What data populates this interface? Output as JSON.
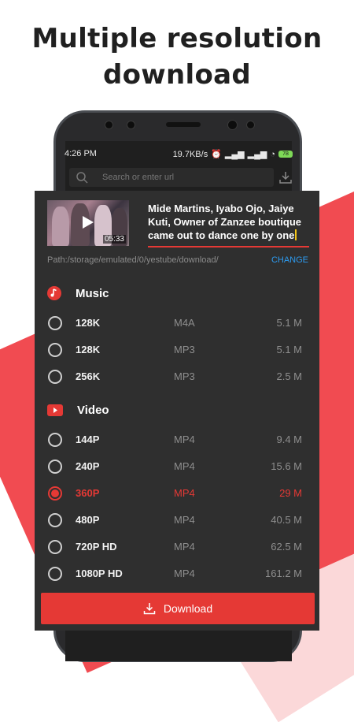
{
  "headline": {
    "line1": "Multiple resolution",
    "line2": "download"
  },
  "status_bar": {
    "time": "4:26 PM",
    "speed": "19.7KB/s",
    "battery": "78"
  },
  "search": {
    "placeholder": "Search or enter url"
  },
  "video": {
    "title": "Mide Martins, Iyabo Ojo, Jaiye Kuti, Owner of Zanzee boutique came out to dance one by one",
    "duration": "05:33"
  },
  "path": {
    "text": "Path:/storage/emulated/0/yestube/download/",
    "change_label": "CHANGE"
  },
  "music": {
    "label": "Music",
    "options": [
      {
        "quality": "128K",
        "format": "M4A",
        "size": "5.1 M",
        "selected": false
      },
      {
        "quality": "128K",
        "format": "MP3",
        "size": "5.1 M",
        "selected": false
      },
      {
        "quality": "256K",
        "format": "MP3",
        "size": "2.5 M",
        "selected": false
      }
    ]
  },
  "video_section": {
    "label": "Video",
    "options": [
      {
        "quality": "144P",
        "format": "MP4",
        "size": "9.4 M",
        "selected": false
      },
      {
        "quality": "240P",
        "format": "MP4",
        "size": "15.6 M",
        "selected": false
      },
      {
        "quality": "360P",
        "format": "MP4",
        "size": "29 M",
        "selected": true
      },
      {
        "quality": "480P",
        "format": "MP4",
        "size": "40.5 M",
        "selected": false
      },
      {
        "quality": "720P HD",
        "format": "MP4",
        "size": "62.5 M",
        "selected": false
      },
      {
        "quality": "1080P HD",
        "format": "MP4",
        "size": "161.2 M",
        "selected": false
      }
    ]
  },
  "download": {
    "label": "Download"
  },
  "colors": {
    "accent": "#e53935",
    "link": "#2d9bf0",
    "panel": "#2f2f2f"
  }
}
